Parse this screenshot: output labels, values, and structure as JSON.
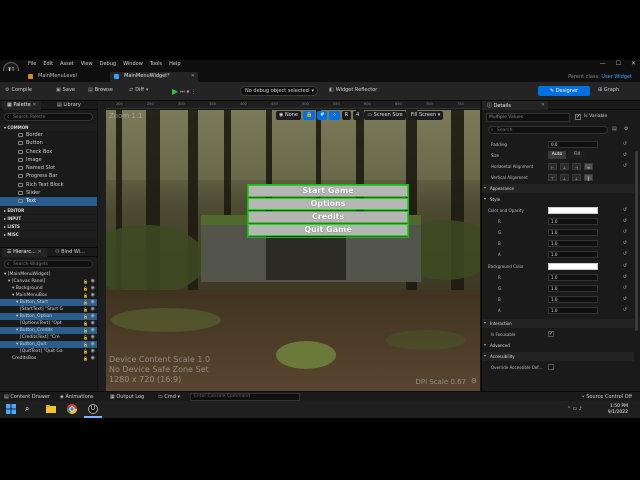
{
  "titlebar": {
    "logo_text": "U",
    "menu": [
      "File",
      "Edit",
      "Asset",
      "View",
      "Debug",
      "Window",
      "Tools",
      "Help"
    ],
    "window_controls": [
      "—",
      "☐",
      "✕"
    ]
  },
  "tabs": [
    {
      "label": "MainMenuLevel",
      "active": false
    },
    {
      "label": "MainMenuWidget*",
      "active": true
    }
  ],
  "parent_class": {
    "label": "Parent class:",
    "value": "User Widget"
  },
  "toolbar": {
    "compile": "Compile",
    "save": "Save",
    "browse": "Browse",
    "diff": "Diff",
    "debug_select": "No debug object selected",
    "widget_reflector": "Widget Reflector",
    "designer": "Designer",
    "graph": "Graph"
  },
  "palette": {
    "tab_palette": "Palette",
    "tab_library": "Library",
    "search_placeholder": "Search Palette",
    "category_common": "COMMON",
    "items": [
      "Border",
      "Button",
      "Check Box",
      "Image",
      "Named Slot",
      "Progress Bar",
      "Rich Text Block",
      "Slider",
      "Text"
    ],
    "categories": [
      "EDITOR",
      "INPUT",
      "LISTS",
      "MISC"
    ]
  },
  "hierarchy": {
    "tab_hierarchy": "Hierarc...",
    "tab_bind": "Bind Wi...",
    "search_placeholder": "Search Widgets",
    "rows": [
      {
        "label": "[MainMenuWidget]",
        "indent": 0,
        "selected": false
      },
      {
        "label": "[Canvas Panel]",
        "indent": 1,
        "selected": false
      },
      {
        "label": "Background",
        "indent": 2,
        "selected": false
      },
      {
        "label": "MainMenuBox",
        "indent": 2,
        "selected": false
      },
      {
        "label": "Button_Start",
        "indent": 3,
        "selected": true
      },
      {
        "label": "[StartText] \"Start G",
        "indent": 4,
        "selected": false
      },
      {
        "label": "Button_Option",
        "indent": 3,
        "selected": true
      },
      {
        "label": "[OptionsText] \"Opt",
        "indent": 4,
        "selected": false
      },
      {
        "label": "Button_Credits",
        "indent": 3,
        "selected": true
      },
      {
        "label": "[CreditsText] \"Cre",
        "indent": 4,
        "selected": false
      },
      {
        "label": "Button_Quit",
        "indent": 3,
        "selected": true
      },
      {
        "label": "[QuitText] \"Quit Ga",
        "indent": 4,
        "selected": false
      },
      {
        "label": "CreditsBox",
        "indent": 2,
        "selected": false
      }
    ]
  },
  "viewport": {
    "zoom": "Zoom 1:1",
    "none": "None",
    "count": "4",
    "screen_size": "Screen Size",
    "fill_screen": "Fill Screen",
    "buttons": [
      "Start Game",
      "Options",
      "Credits",
      "Quit Game"
    ],
    "device_content_scale": "Device Content Scale 1.0",
    "no_safe_zone": "No Device Safe Zone Set",
    "resolution": "1280 x 720 (16:9)",
    "dpi_scale": "DPI Scale 0.67",
    "ruler": [
      "200",
      "250",
      "300",
      "350",
      "400",
      "450",
      "500",
      "550",
      "600",
      "650",
      "700",
      "750"
    ]
  },
  "details": {
    "tab": "Details",
    "multiple_values": "Multiple Values",
    "is_variable": "Is Variable",
    "search_placeholder": "Search",
    "padding_label": "Padding",
    "padding_value": "0.0",
    "size_label": "Size",
    "size_auto": "Auto",
    "size_fill": "Fill",
    "halign_label": "Horizontal Alignment",
    "valign_label": "Vertical Alignment",
    "appearance": "Appearance",
    "style": "Style",
    "color_opacity": "Color and Opacity",
    "rgba": [
      "R",
      "G",
      "B",
      "A"
    ],
    "rgba_values": [
      "1.0",
      "1.0",
      "1.0",
      "1.0"
    ],
    "background_color": "Background Color",
    "bg_values": [
      "1.0",
      "1.0",
      "1.0",
      "1.0"
    ],
    "interaction": "Interaction",
    "is_focusable": "Is Focusable",
    "advanced": "Advanced",
    "accessibility": "Accessibility",
    "override_accessible": "Override Accessible Def..."
  },
  "bottombar": {
    "content_drawer": "Content Drawer",
    "animations": "Animations",
    "output_log": "Output Log",
    "cmd": "Cmd",
    "console_placeholder": "Enter Console Command",
    "source_control": "Source Control Off"
  },
  "taskbar": {
    "time": "1:50 PM",
    "date": "9/1/2022"
  },
  "colors": {
    "accent": "#0070e0",
    "selection": "#2a5d8c",
    "button_outline": "#27d027",
    "button_fill": "#b5b5b5"
  }
}
